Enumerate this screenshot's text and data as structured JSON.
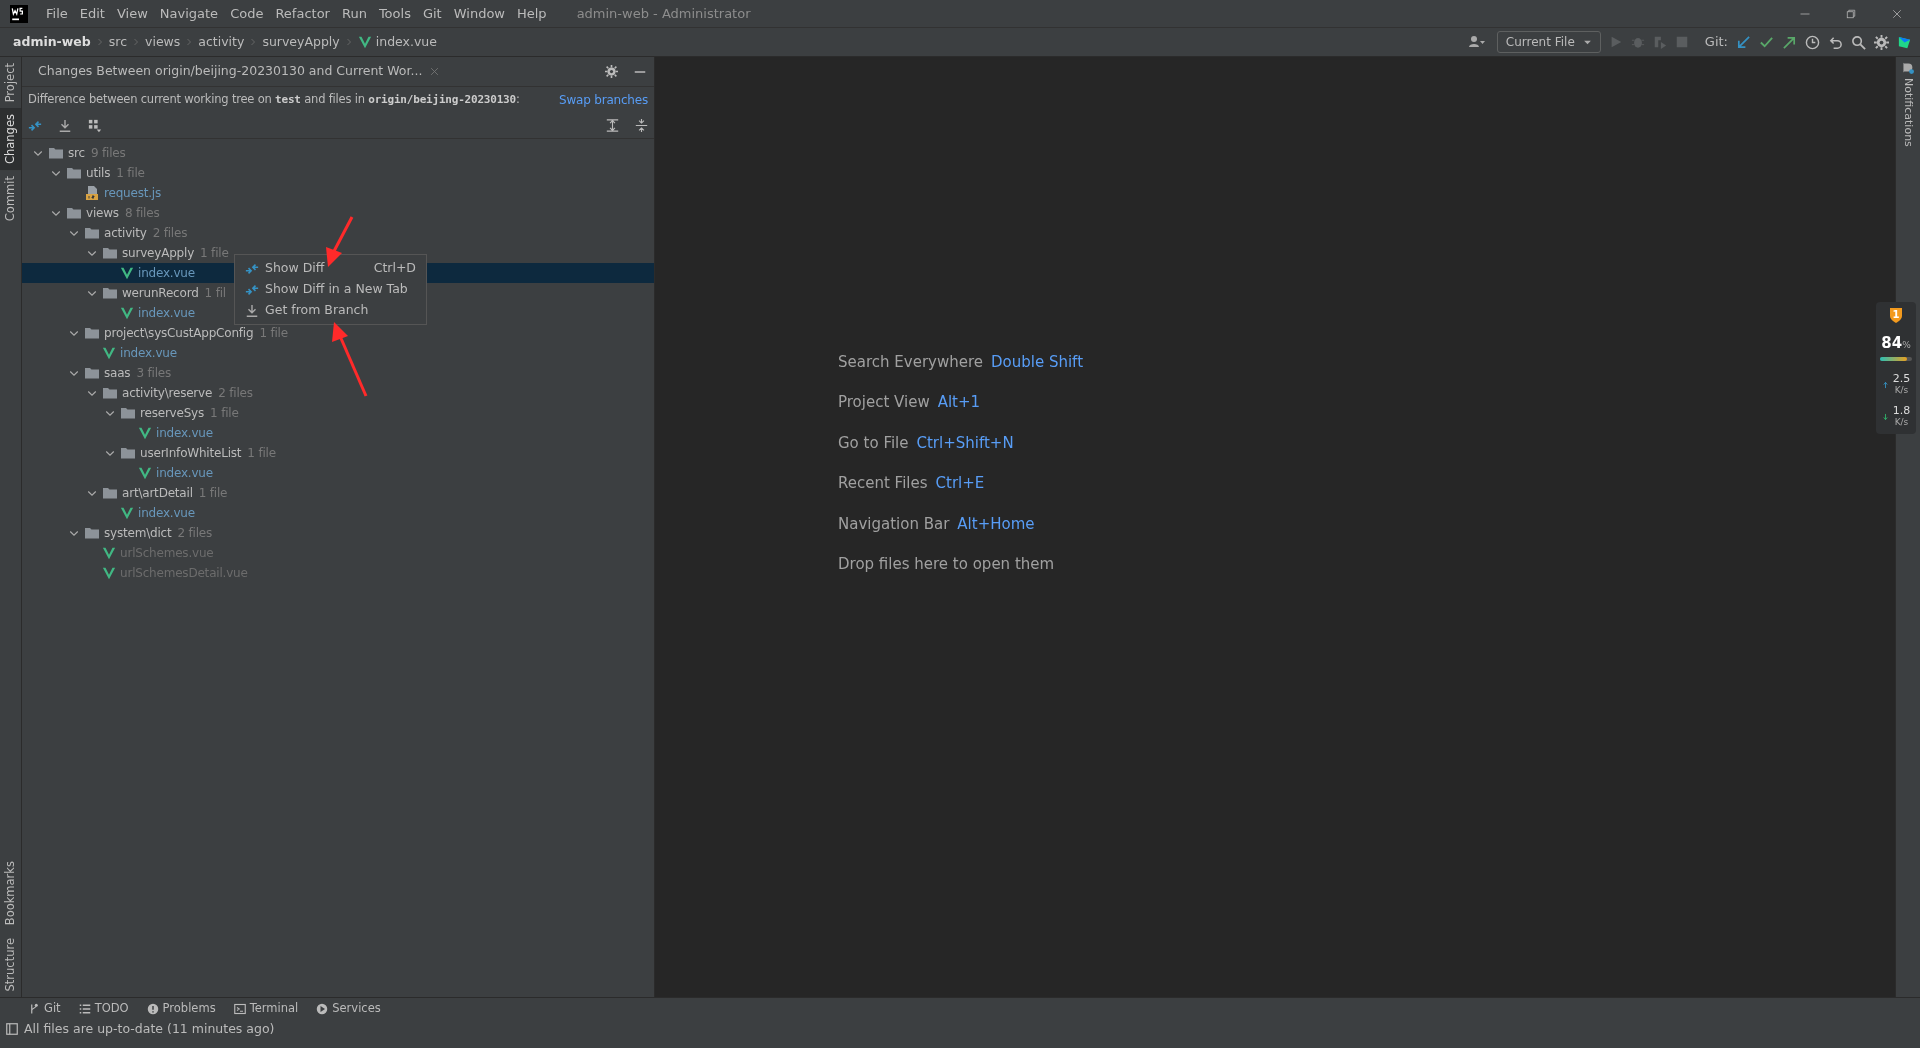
{
  "menu_bar": {
    "items": [
      "File",
      "Edit",
      "View",
      "Navigate",
      "Code",
      "Refactor",
      "Run",
      "Tools",
      "Git",
      "Window",
      "Help"
    ],
    "title": "admin-web - Administrator"
  },
  "breadcrumbs": [
    {
      "label": "admin-web",
      "kind": "project"
    },
    {
      "label": "src",
      "kind": "folder"
    },
    {
      "label": "views",
      "kind": "folder"
    },
    {
      "label": "activity",
      "kind": "folder"
    },
    {
      "label": "surveyApply",
      "kind": "folder"
    },
    {
      "label": "index.vue",
      "kind": "vue"
    }
  ],
  "toolbar": {
    "run_config": "Current File",
    "run_enabled": false,
    "git_label": "Git:"
  },
  "left_tabs": {
    "top": [
      {
        "label": "Project",
        "selected": false
      },
      {
        "label": "Changes",
        "selected": true
      },
      {
        "label": "Commit",
        "selected": false
      }
    ],
    "bottom": [
      {
        "label": "Bookmarks",
        "selected": false
      },
      {
        "label": "Structure",
        "selected": false
      }
    ]
  },
  "panel": {
    "title": "Changes Between origin/beijing-20230130 and Current Wor...",
    "description": "Difference between current working tree on **test** and files in **origin/beijing-20230130**:",
    "link": "Swap branches",
    "tree": [
      {
        "name": "src",
        "count": "9 files",
        "kind": "folder",
        "expanded": true,
        "children": [
          {
            "name": "utils",
            "count": "1 file",
            "kind": "folder",
            "expanded": true,
            "children": [
              {
                "name": "request.js",
                "kind": "js",
                "deleted": false,
                "selected": false
              }
            ]
          },
          {
            "name": "views",
            "count": "8 files",
            "kind": "folder",
            "expanded": true,
            "children": [
              {
                "name": "activity",
                "count": "2 files",
                "kind": "folder",
                "expanded": true,
                "children": [
                  {
                    "name": "surveyApply",
                    "count": "1 file",
                    "kind": "folder",
                    "expanded": true,
                    "children": [
                      {
                        "name": "index.vue",
                        "kind": "vue",
                        "deleted": false,
                        "selected": true
                      }
                    ]
                  },
                  {
                    "name": "werunRecord",
                    "count": "1 fil",
                    "kind": "folder",
                    "expanded": true,
                    "children": [
                      {
                        "name": "index.vue",
                        "kind": "vue",
                        "deleted": false,
                        "selected": false
                      }
                    ]
                  }
                ]
              },
              {
                "name": "project\\sysCustAppConfig",
                "count": "1 file",
                "kind": "folder",
                "expanded": true,
                "children": [
                  {
                    "name": "index.vue",
                    "kind": "vue",
                    "deleted": false,
                    "selected": false
                  }
                ]
              },
              {
                "name": "saas",
                "count": "3 files",
                "kind": "folder",
                "expanded": true,
                "children": [
                  {
                    "name": "activity\\reserve",
                    "count": "2 files",
                    "kind": "folder",
                    "expanded": true,
                    "children": [
                      {
                        "name": "reserveSys",
                        "count": "1 file",
                        "kind": "folder",
                        "expanded": true,
                        "children": [
                          {
                            "name": "index.vue",
                            "kind": "vue",
                            "deleted": false,
                            "selected": false
                          }
                        ]
                      },
                      {
                        "name": "userInfoWhiteList",
                        "count": "1 file",
                        "kind": "folder",
                        "expanded": true,
                        "children": [
                          {
                            "name": "index.vue",
                            "kind": "vue",
                            "deleted": false,
                            "selected": false
                          }
                        ]
                      }
                    ]
                  },
                  {
                    "name": "art\\artDetail",
                    "count": "1 file",
                    "kind": "folder",
                    "expanded": true,
                    "children": [
                      {
                        "name": "index.vue",
                        "kind": "vue",
                        "deleted": false,
                        "selected": false
                      }
                    ]
                  }
                ]
              },
              {
                "name": "system\\dict",
                "count": "2 files",
                "kind": "folder",
                "expanded": true,
                "children": [
                  {
                    "name": "urlSchemes.vue",
                    "kind": "vue",
                    "deleted": true,
                    "selected": false
                  },
                  {
                    "name": "urlSchemesDetail.vue",
                    "kind": "vue",
                    "deleted": true,
                    "selected": false
                  }
                ]
              }
            ]
          }
        ]
      }
    ]
  },
  "context_menu": [
    {
      "label": "Show Diff",
      "shortcut": "Ctrl+D",
      "kind": "diff"
    },
    {
      "label": "Show Diff in a New Tab",
      "kind": "diff"
    },
    {
      "label": "Get from Branch",
      "kind": "download"
    }
  ],
  "annotation_arrows": [
    {
      "pointing_up": false
    },
    {
      "pointing_up": true
    }
  ],
  "editor_hints": [
    {
      "label": "Search Everywhere",
      "shortcut": "Double Shift"
    },
    {
      "label": "Project View",
      "shortcut": "Alt+1"
    },
    {
      "label": "Go to File",
      "shortcut": "Ctrl+Shift+N"
    },
    {
      "label": "Recent Files",
      "shortcut": "Ctrl+E"
    },
    {
      "label": "Navigation Bar",
      "shortcut": "Alt+Home"
    },
    {
      "label": "Drop files here to open them"
    }
  ],
  "right_tabs": [
    {
      "label": "Notifications",
      "unread": true
    }
  ],
  "monitor": {
    "badge": "1",
    "cpu": "84",
    "cpu_unit": "%",
    "level": 0.84,
    "upload": "2.5",
    "upload_unit": "K/s",
    "download": "1.8",
    "download_unit": "K/s"
  },
  "tool_windows": [
    {
      "label": "Git",
      "kind": "git"
    },
    {
      "label": "TODO",
      "kind": "todo"
    },
    {
      "label": "Problems",
      "kind": "problems"
    },
    {
      "label": "Terminal",
      "kind": "terminal"
    },
    {
      "label": "Services",
      "kind": "services"
    }
  ],
  "status_bar": "All files are up-to-date (11 minutes ago)"
}
